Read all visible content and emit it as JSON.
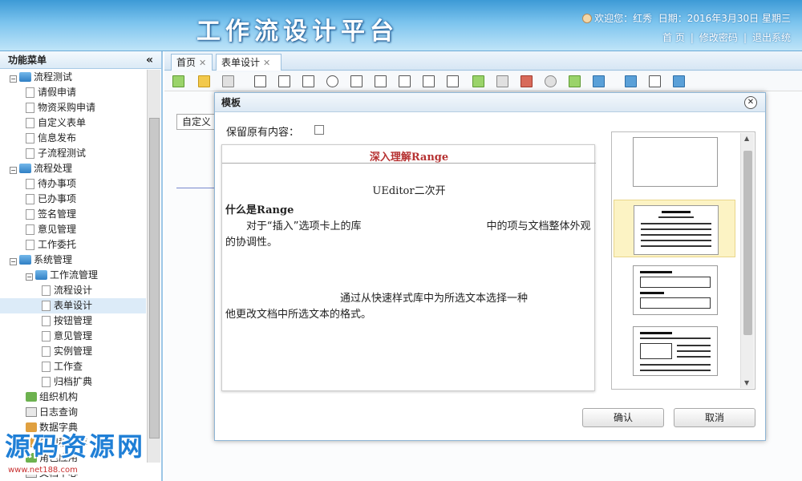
{
  "header": {
    "title": "工作流设计平台",
    "welcome": "欢迎您：红秀",
    "date": "日期：2016年3月30日 星期三",
    "links": [
      "首 页",
      "修改密码",
      "退出系统"
    ],
    "separator": "|"
  },
  "sidebar": {
    "title": "功能菜单",
    "collapse_glyph": "«",
    "tree": [
      {
        "label": "流程测试",
        "level": 0,
        "kind": "folder",
        "toggle": "−"
      },
      {
        "label": "请假申请",
        "level": 1,
        "kind": "page"
      },
      {
        "label": "物资采购申请",
        "level": 1,
        "kind": "page"
      },
      {
        "label": "自定义表单",
        "level": 1,
        "kind": "page"
      },
      {
        "label": "信息发布",
        "level": 1,
        "kind": "page"
      },
      {
        "label": "子流程测试",
        "level": 1,
        "kind": "page"
      },
      {
        "label": "流程处理",
        "level": 0,
        "kind": "folder",
        "toggle": "−"
      },
      {
        "label": "待办事项",
        "level": 1,
        "kind": "page"
      },
      {
        "label": "已办事项",
        "level": 1,
        "kind": "page"
      },
      {
        "label": "签名管理",
        "level": 1,
        "kind": "page"
      },
      {
        "label": "意见管理",
        "level": 1,
        "kind": "page"
      },
      {
        "label": "工作委托",
        "level": 1,
        "kind": "page"
      },
      {
        "label": "系统管理",
        "level": 0,
        "kind": "folder",
        "toggle": "−"
      },
      {
        "label": "工作流管理",
        "level": 1,
        "kind": "folder",
        "toggle": "−"
      },
      {
        "label": "流程设计",
        "level": 2,
        "kind": "page"
      },
      {
        "label": "表单设计",
        "level": 2,
        "kind": "page",
        "selected": true
      },
      {
        "label": "按钮管理",
        "level": 2,
        "kind": "page"
      },
      {
        "label": "意见管理",
        "level": 2,
        "kind": "page"
      },
      {
        "label": "实例管理",
        "level": 2,
        "kind": "page"
      },
      {
        "label": "工作查",
        "level": 2,
        "kind": "page"
      },
      {
        "label": "归档扩典",
        "level": 2,
        "kind": "page"
      },
      {
        "label": "组织机构",
        "level": 1,
        "kind": "org"
      },
      {
        "label": "日志查询",
        "level": 1,
        "kind": "log"
      },
      {
        "label": "数据字典",
        "level": 1,
        "kind": "dict"
      },
      {
        "label": "应用程序库",
        "level": 1,
        "kind": "dict"
      },
      {
        "label": "角色应用",
        "level": 1,
        "kind": "org"
      },
      {
        "label": "文档中心",
        "level": 1,
        "kind": "log"
      }
    ]
  },
  "watermark": {
    "text": "源码资源网",
    "url": "www.net188.com"
  },
  "tabs": [
    {
      "label": "首页",
      "close": "✕"
    },
    {
      "label": "表单设计",
      "close": "✕"
    }
  ],
  "editor": {
    "font_select": "自定义"
  },
  "dialog": {
    "title": "模板",
    "close_glyph": "✕",
    "keep_label": "保留原有内容：",
    "preview": {
      "title": "深入理解Range",
      "subtitle": "UEditor二次开",
      "heading": "什么是Range",
      "para1": "对于“插入”选项卡上的库　　　　　　　　　　　　中的项与文档整体外观的协调性。",
      "para2": "　　　　　　　　　通过从快速样式库中为所选文本选择一种　　　　　　　　　　　　　　　　　　他更改文档中所选文本的格式。"
    },
    "scroll_up": "▲",
    "scroll_down": "▼",
    "confirm_label": "确认",
    "cancel_label": "取消"
  }
}
